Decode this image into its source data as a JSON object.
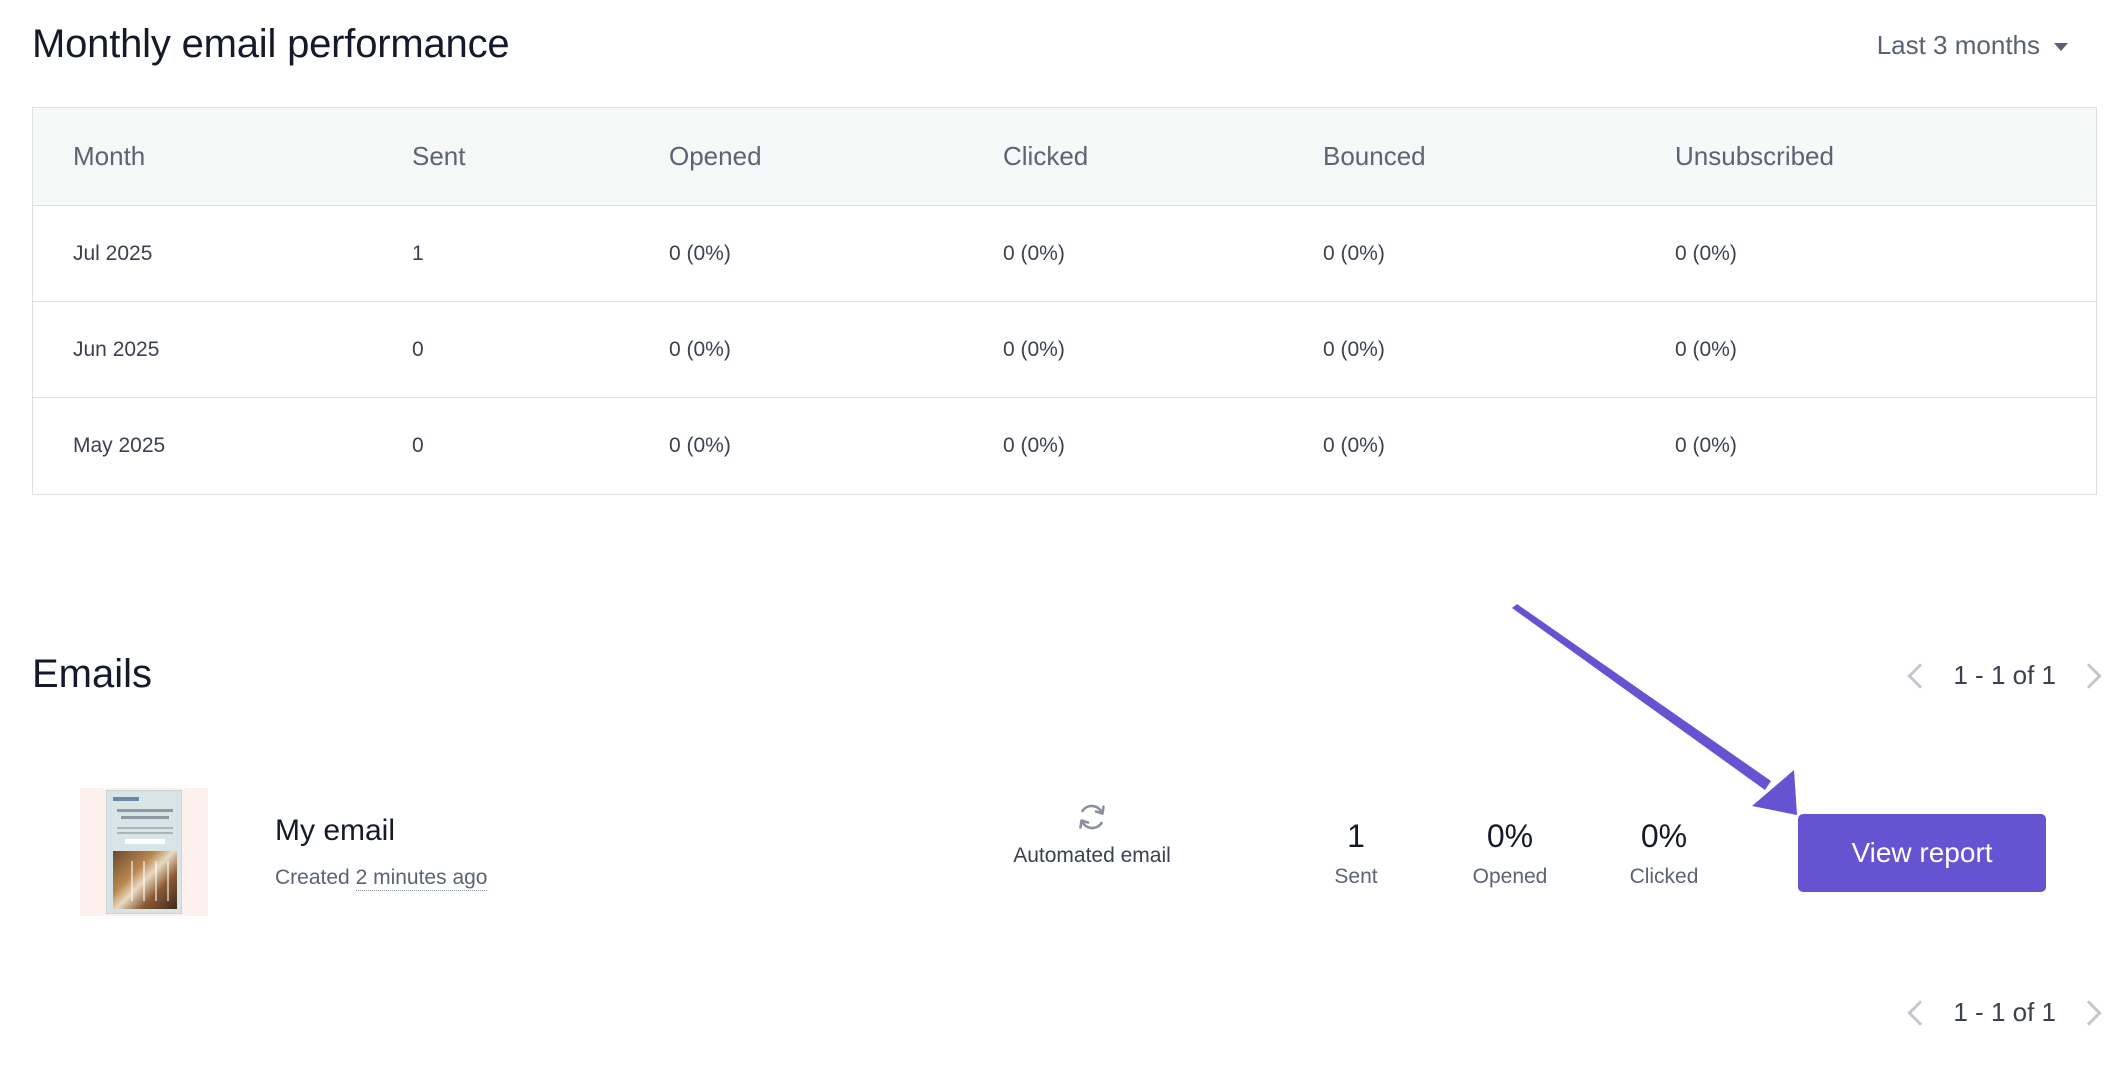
{
  "performance": {
    "title": "Monthly email performance",
    "range_label": "Last 3 months",
    "columns": [
      "Month",
      "Sent",
      "Opened",
      "Clicked",
      "Bounced",
      "Unsubscribed"
    ],
    "rows": [
      [
        "Jul 2025",
        "1",
        "0 (0%)",
        "0 (0%)",
        "0 (0%)",
        "0 (0%)"
      ],
      [
        "Jun 2025",
        "0",
        "0 (0%)",
        "0 (0%)",
        "0 (0%)",
        "0 (0%)"
      ],
      [
        "May 2025",
        "0",
        "0 (0%)",
        "0 (0%)",
        "0 (0%)",
        "0 (0%)"
      ]
    ]
  },
  "emails": {
    "title": "Emails",
    "pagination": "1 - 1 of 1",
    "items": [
      {
        "name": "My email",
        "created_prefix": "Created",
        "created_ago": "2 minutes ago",
        "type_icon": "refresh-icon",
        "type_label": "Automated email",
        "sent_value": "1",
        "sent_label": "Sent",
        "opened_value": "0%",
        "opened_label": "Opened",
        "clicked_value": "0%",
        "clicked_label": "Clicked",
        "action_label": "View report"
      }
    ]
  },
  "colors": {
    "accent": "#6553d2",
    "annotation_arrow": "#6553d2",
    "table_header_bg": "#f7f8f8",
    "border": "#dcdfe4"
  }
}
